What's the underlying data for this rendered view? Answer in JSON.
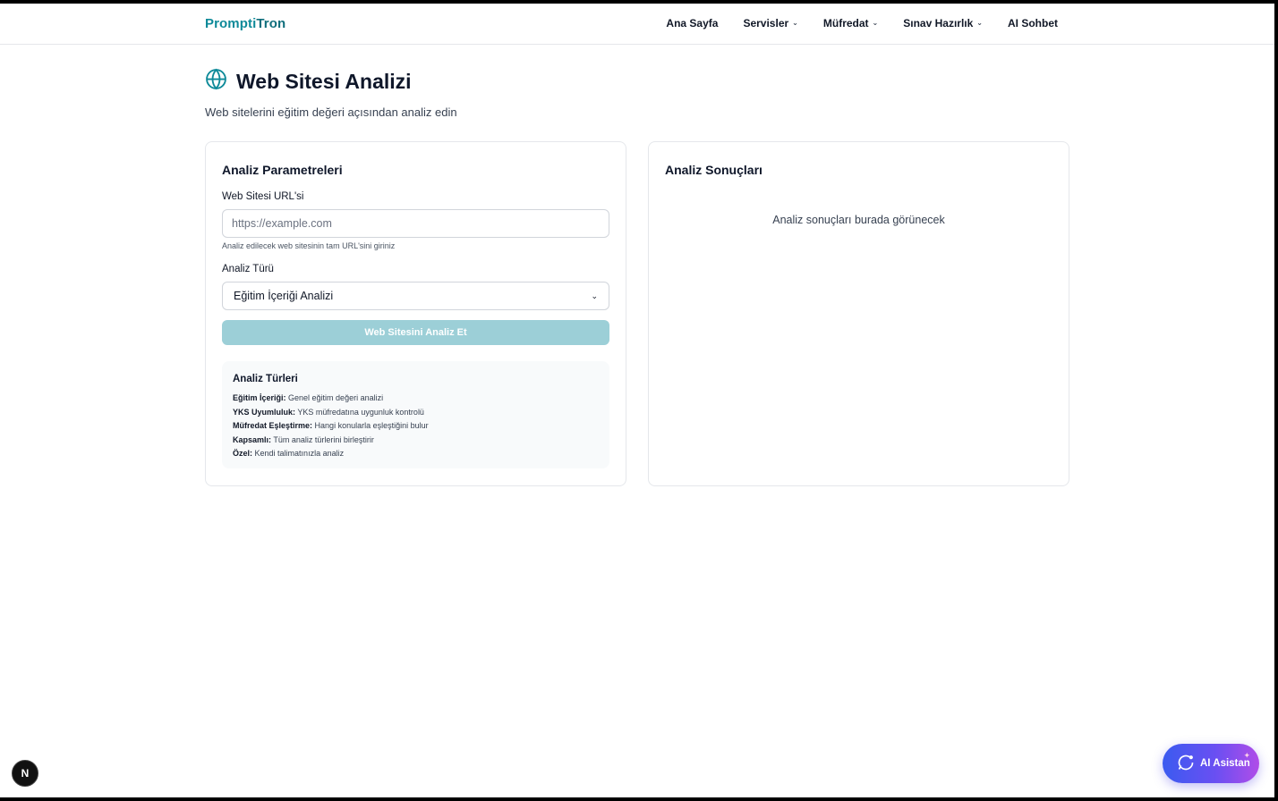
{
  "header": {
    "brand_part1": "Prompti",
    "brand_part2": "Tron",
    "nav": [
      {
        "label": "Ana Sayfa",
        "dropdown": false
      },
      {
        "label": "Servisler",
        "dropdown": true
      },
      {
        "label": "Müfredat",
        "dropdown": true
      },
      {
        "label": "Sınav Hazırlık",
        "dropdown": true
      },
      {
        "label": "AI Sohbet",
        "dropdown": false
      }
    ]
  },
  "page": {
    "title": "Web Sitesi Analizi",
    "title_icon": "globe-icon",
    "subtitle": "Web sitelerini eğitim değeri açısından analiz edin"
  },
  "params": {
    "title": "Analiz Parametreleri",
    "url_label": "Web Sitesi URL'si",
    "url_value": "",
    "url_placeholder": "https://example.com",
    "url_hint": "Analiz edilecek web sitesinin tam URL'sini giriniz",
    "type_label": "Analiz Türü",
    "type_selected": "Eğitim İçeriği Analizi",
    "submit_label": "Web Sitesini Analiz Et",
    "info": {
      "title": "Analiz Türleri",
      "items": [
        {
          "name": "Eğitim İçeriği:",
          "desc": "Genel eğitim değeri analizi"
        },
        {
          "name": "YKS Uyumluluk:",
          "desc": "YKS müfredatına uygunluk kontrolü"
        },
        {
          "name": "Müfredat Eşleştirme:",
          "desc": "Hangi konularla eşleştiğini bulur"
        },
        {
          "name": "Kapsamlı:",
          "desc": "Tüm analiz türlerini birleştirir"
        },
        {
          "name": "Özel:",
          "desc": "Kendi talimatınızla analiz"
        }
      ]
    }
  },
  "results": {
    "title": "Analiz Sonuçları",
    "empty_text": "Analiz sonuçları burada görünecek"
  },
  "floating": {
    "next_badge": "N",
    "assistant_label": "AI Asistan"
  },
  "colors": {
    "brand": "#0e8a99",
    "button_disabled": "#9ccfd7",
    "assistant_gradient_start": "#3b5bf0",
    "assistant_gradient_end": "#b04de8"
  }
}
